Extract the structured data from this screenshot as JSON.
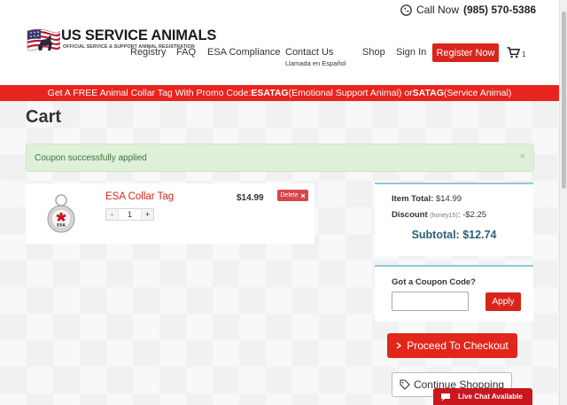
{
  "header": {
    "phone_label": "Call Now",
    "phone_number": "(985) 570-5386",
    "logo_title": "US SERVICE ANIMALS",
    "logo_subtitle": "OFFICIAL SERVICE & SUPPORT ANIMAL REGISTRATION",
    "nav": {
      "registry": "Registry",
      "faq": "FAQ",
      "esa_compliance": "ESA Compliance",
      "contact_us": "Contact Us",
      "contact_sub": "Llamada en Español",
      "shop": "Shop",
      "sign_in": "Sign In",
      "register": "Register Now"
    },
    "cart_count": "1"
  },
  "promo": {
    "prefix": "Get A FREE Animal Collar Tag With Promo Code: ",
    "code1": "ESATAG",
    "middle": " (Emotional Support Animal) or ",
    "code2": "SATAG",
    "suffix": " (Service Animal)"
  },
  "page": {
    "title": "Cart",
    "alert": "Coupon successfully applied",
    "alert_close": "×"
  },
  "item": {
    "name": "ESA Collar Tag",
    "price": "$14.99",
    "quantity": "1",
    "minus": "-",
    "plus": "+",
    "delete_label": "Delete",
    "tag_letters": "ESA"
  },
  "summary": {
    "item_total_label": "Item Total:",
    "item_total_value": "$14.99",
    "discount_label": "Discount",
    "discount_code": "(honey15)",
    "discount_value": ": -$2.25",
    "subtotal": "Subtotal: $12.74"
  },
  "coupon": {
    "label": "Got a Coupon Code?",
    "value": "",
    "placeholder": "",
    "apply_label": "Apply"
  },
  "actions": {
    "checkout_label": "Proceed To Checkout",
    "continue_label": "Continue Shopping"
  },
  "chat": {
    "label": "Live Chat Available"
  },
  "colors": {
    "accent_red": "#d9261c",
    "promo_red": "#e8241f",
    "alert_bg": "#dff0d8",
    "alert_text": "#3c763d",
    "subtotal_blue": "#2e5f78",
    "card_border": "#8fc8dc"
  }
}
